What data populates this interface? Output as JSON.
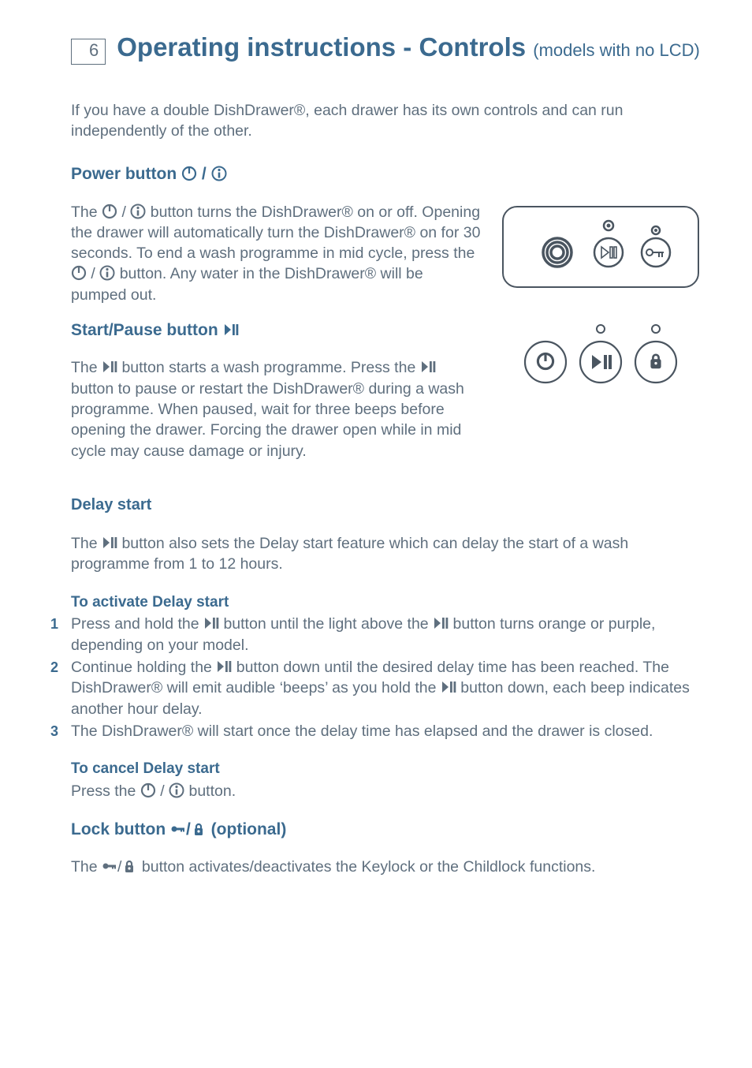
{
  "page_number": "6",
  "title_main": "Operating instructions - Controls",
  "title_sub": "(models with no LCD)",
  "intro": "If you have a double DishDrawer®, each drawer has its own controls and can run independently of the other.",
  "power": {
    "heading_pre": "Power button ",
    "p1a": "The ",
    "p1b": " button turns the DishDrawer® on or off.  Opening the drawer will automatically turn the DishDrawer® on for 30 seconds.  To end a wash programme in mid cycle, press the ",
    "p1c": " button.  Any water in the DishDrawer® will be  pumped out."
  },
  "startpause": {
    "heading_pre": "Start/Pause button ",
    "p1a": "The ",
    "p1b": " button starts a wash programme.  Press the ",
    "p1c": " button to pause or restart the DishDrawer® during a wash programme.  When paused, wait for three beeps before opening the drawer.  Forcing the drawer open while in mid cycle may cause damage or injury."
  },
  "delay": {
    "heading": "Delay start",
    "p1a": "The ",
    "p1b": " button also sets the Delay start feature which can delay the start of a wash programme from 1 to 12 hours.",
    "activate_heading": "To activate Delay start",
    "step1a": "Press and hold the ",
    "step1b": " button until the light above the ",
    "step1c": " button turns orange or purple, depending on your model.",
    "step2a": "Continue holding the ",
    "step2b": " button down until the desired delay time has been reached.  The DishDrawer® will emit audible ‘beeps’ as you hold the ",
    "step2c": " button down, each beep indicates another hour delay.",
    "step3": "The DishDrawer® will start once the delay time has elapsed and the drawer is closed.",
    "cancel_heading": "To cancel Delay start",
    "cancel_a": "Press the ",
    "cancel_b": " button."
  },
  "lock": {
    "heading_pre": "Lock button ",
    "heading_post": " (optional)",
    "p1a": "The ",
    "p1b": "  button activates/deactivates the Keylock or the Childlock functions."
  },
  "sep": " / "
}
